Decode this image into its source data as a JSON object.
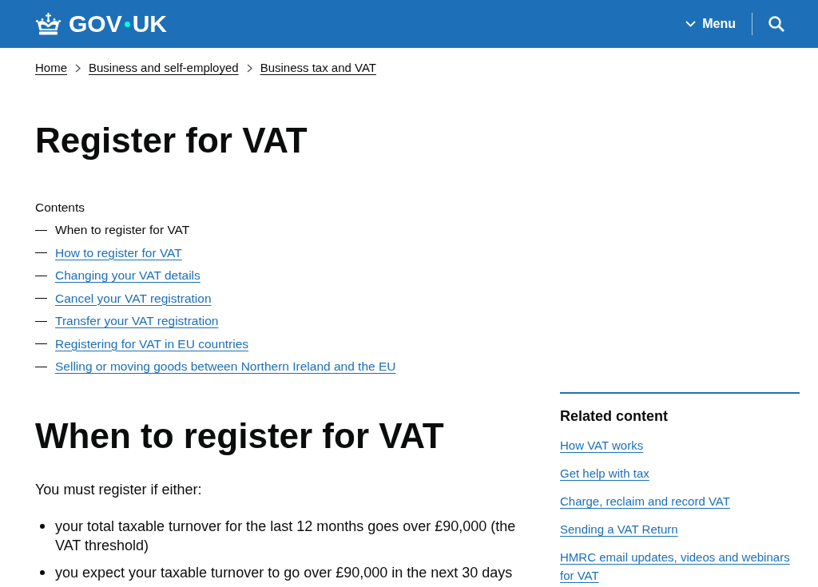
{
  "header": {
    "logo": {
      "before_dot": "GOV",
      "after_dot": "UK"
    },
    "menu_button": {
      "label": "Menu",
      "expanded": false
    }
  },
  "breadcrumbs": [
    "Home",
    "Business and self-employed",
    "Business tax and VAT"
  ],
  "page_title": "Register for VAT",
  "contents": {
    "heading": "Contents",
    "items": [
      {
        "label": "When to register for VAT",
        "selected": true
      },
      {
        "label": "How to register for VAT",
        "selected": false
      },
      {
        "label": "Changing your VAT details",
        "selected": false
      },
      {
        "label": "Cancel your VAT registration",
        "selected": false
      },
      {
        "label": "Transfer your VAT registration",
        "selected": false
      },
      {
        "label": "Registering for VAT in EU countries",
        "selected": false
      },
      {
        "label": "Selling or moving goods between Northern Ireland and the EU",
        "selected": false
      }
    ]
  },
  "section": {
    "heading": "When to register for VAT",
    "intro": "You must register if either:",
    "bullets": [
      "your total taxable turnover for the last 12 months goes over £90,000 (the VAT threshold)",
      "you expect your taxable turnover to go over £90,000 in the next 30 days"
    ]
  },
  "related": {
    "heading": "Related content",
    "links": [
      "How VAT works",
      "Get help with tax",
      "Charge, reclaim and record VAT",
      "Sending a VAT Return",
      "HMRC email updates, videos and webinars for VAT"
    ]
  }
}
